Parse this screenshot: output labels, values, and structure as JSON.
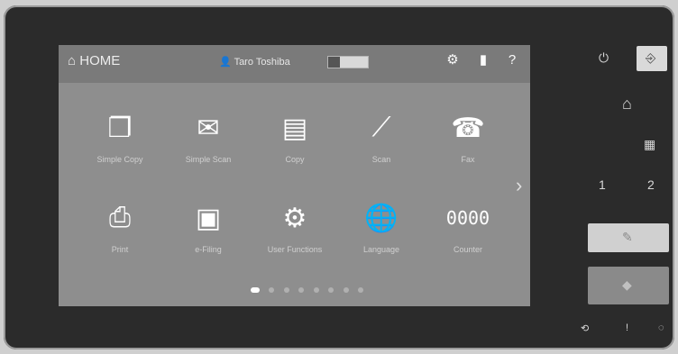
{
  "header": {
    "home_label": "HOME",
    "user_name": "Taro Toshiba",
    "settings_icon": "gear-icon",
    "info_icon": "info-icon",
    "help_icon": "help-icon"
  },
  "apps": [
    {
      "label": "Simple Copy",
      "icon": "copy-icon"
    },
    {
      "label": "Simple Scan",
      "icon": "scan-mail-icon"
    },
    {
      "label": "Copy",
      "icon": "copier-icon"
    },
    {
      "label": "Scan",
      "icon": "scanner-icon"
    },
    {
      "label": "Fax",
      "icon": "fax-icon"
    },
    {
      "label": "Print",
      "icon": "printer-icon"
    },
    {
      "label": "e-Filing",
      "icon": "box-icon"
    },
    {
      "label": "User Functions",
      "icon": "gears-icon"
    },
    {
      "label": "Language",
      "icon": "globe-icon"
    },
    {
      "label": "Counter",
      "icon": "counter-icon"
    }
  ],
  "pager": {
    "pages": 8,
    "active": 1
  },
  "side_panel": {
    "power_icon": "power-icon",
    "login_icon": "login-icon",
    "home_icon": "home-icon",
    "job_status_icon": "job-status-icon",
    "keypad_1": "1",
    "keypad_2": "2",
    "start_button_color": "#d0d0d0",
    "stop_button_color": "#8a8a8a"
  }
}
